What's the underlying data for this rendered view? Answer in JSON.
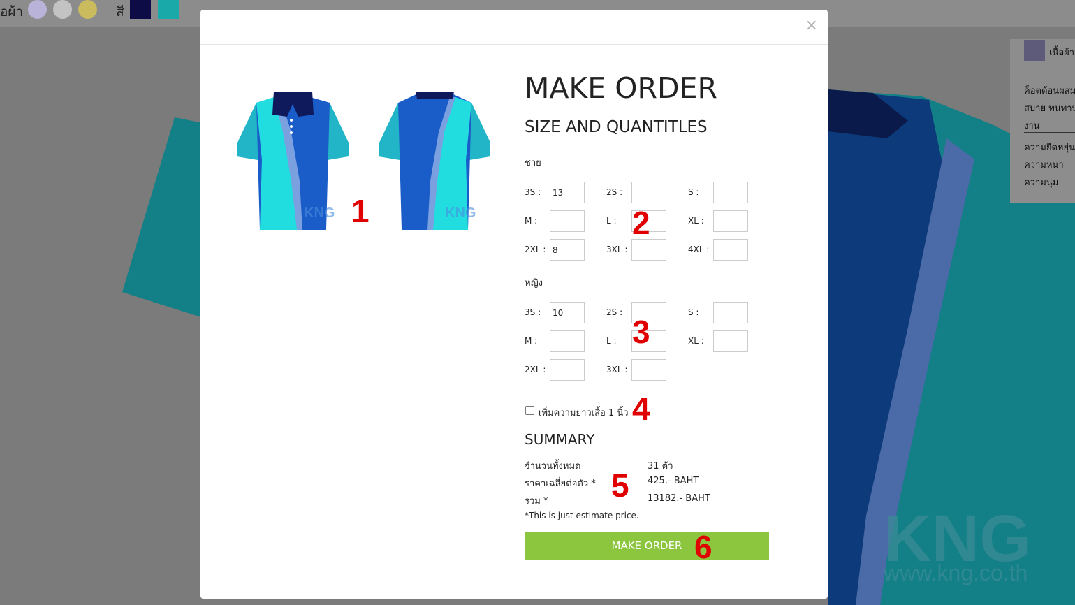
{
  "background": {
    "fabric_color_label": "อผ้า",
    "color_label": "สี",
    "fabric_swatches": [
      "#b9b3d9",
      "#c3c3c3",
      "#c9bb5e"
    ],
    "color_swatches": [
      "#0d0c47",
      "#1aa9a9"
    ],
    "side_panel": {
      "fabric_title": "เนื้อผ้า",
      "lines": [
        "ค็อตต้อนผสม",
        "สบาย ทนทาน",
        "งาน",
        "ความยืดหยุ่น",
        "ความหนา",
        "ความนุ่ม"
      ]
    }
  },
  "modal": {
    "close_symbol": "×",
    "title": "MAKE ORDER",
    "subtitle": "SIZE AND QUANTITLES",
    "male": {
      "label": "ชาย",
      "sizes": [
        {
          "label": "3S :",
          "value": "13"
        },
        {
          "label": "2S :",
          "value": ""
        },
        {
          "label": "S :",
          "value": ""
        },
        {
          "label": "M :",
          "value": ""
        },
        {
          "label": "L :",
          "value": ""
        },
        {
          "label": "XL :",
          "value": ""
        },
        {
          "label": "2XL :",
          "value": "8"
        },
        {
          "label": "3XL :",
          "value": ""
        },
        {
          "label": "4XL :",
          "value": ""
        }
      ]
    },
    "female": {
      "label": "หญิง",
      "sizes": [
        {
          "label": "3S :",
          "value": "10"
        },
        {
          "label": "2S :",
          "value": ""
        },
        {
          "label": "S :",
          "value": ""
        },
        {
          "label": "M :",
          "value": ""
        },
        {
          "label": "L :",
          "value": ""
        },
        {
          "label": "XL :",
          "value": ""
        },
        {
          "label": "2XL :",
          "value": ""
        },
        {
          "label": "3XL :",
          "value": ""
        }
      ]
    },
    "extend_length": {
      "label": "เพิ่มความยาวเสื้อ 1 นิ้ว",
      "checked": false
    },
    "summary": {
      "title": "SUMMARY",
      "total_qty_label": "จำนวนทั้งหมด",
      "total_qty_value": "31 ตัว",
      "avg_price_label": "ราคาเฉลี่ยต่อตัว *",
      "avg_price_value": "425.- BAHT",
      "sum_label": "รวม *",
      "sum_value": "13182.- BAHT",
      "note": "*This is just estimate price."
    },
    "submit_label": "MAKE ORDER",
    "shirt_watermark": "KNG",
    "shirt_watermark_url": "www.kng.co.th"
  },
  "markers": [
    "1",
    "2",
    "3",
    "4",
    "5",
    "6"
  ],
  "colors": {
    "accent_green": "#8cc63f",
    "marker_red": "#e00000",
    "shirt_navy": "#0e1a5c",
    "shirt_blue": "#1a5cc8",
    "shirt_cyan": "#22c7d6"
  }
}
